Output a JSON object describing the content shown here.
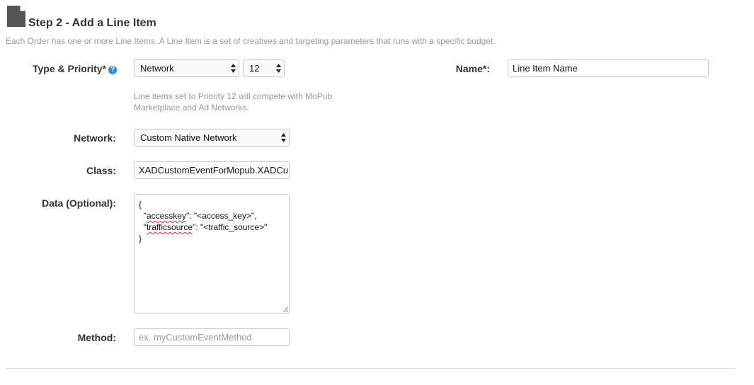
{
  "header": {
    "icon": "document-icon",
    "title": "Step 2 - Add a Line Item",
    "description": "Each Order has one or more Line Items. A Line Item is a set of creatives and targeting parameters that runs with a specific budget."
  },
  "form": {
    "type_priority": {
      "label": "Type & Priority*",
      "help_icon": "question-circle-icon",
      "help_glyph": "?",
      "type_value": "Network",
      "priority_value": "12",
      "hint": "Line items set to Priority 12 will compete with MoPub Marketplace and Ad Networks."
    },
    "name": {
      "label": "Name*:",
      "value": "Line Item Name"
    },
    "network": {
      "label": "Network:",
      "value": "Custom Native Network"
    },
    "class": {
      "label": "Class:",
      "value": "XADCustomEventForMopub.XADCu"
    },
    "data": {
      "label": "Data (Optional):",
      "lines": {
        "open": "{",
        "line1_pre": "  \"",
        "line1_key": "accesskey",
        "line1_post": "\": \"<access_key>\",",
        "line2_pre": "  \"",
        "line2_key": "trafficsource",
        "line2_post": "\": \"<traffic_source>\"",
        "close": "}"
      }
    },
    "method": {
      "label": "Method:",
      "placeholder": "ex. myCustomEventMethod"
    }
  },
  "colors": {
    "help_icon": "#2a8fd6",
    "hint_text": "#999999",
    "spellcheck": "#e03030"
  }
}
